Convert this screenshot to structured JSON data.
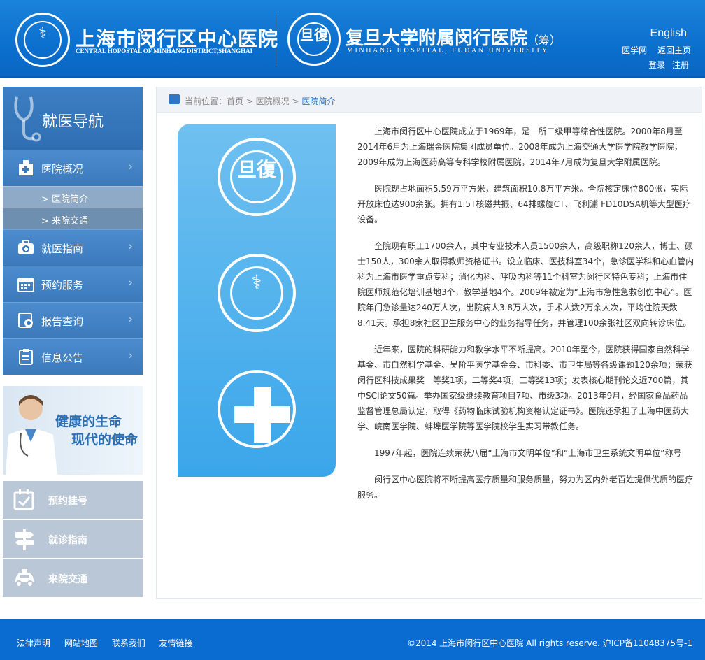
{
  "header": {
    "logo1_glyph": "⚕",
    "hospital_cn": "上海市闵行区中心医院",
    "hospital_en": "CENTRAL HOPOSTAL OF MINHANG DISTRICT,SHANGHAI",
    "logo2_glyph": "旦復",
    "fudan_cn": "复旦大学附属闵行医院",
    "fudan_suffix": "（筹）",
    "fudan_en": "MINHANG HOSPITAL, FUDAN UNIVERSITY",
    "english": "English",
    "links": [
      "医学网",
      "返回主页"
    ],
    "links2": [
      "登录",
      "注册"
    ]
  },
  "sidebar": {
    "title": "就医导航",
    "items": [
      {
        "label": "医院概况",
        "icon": "hospital-icon"
      },
      {
        "label": "就医指南",
        "icon": "medkit-icon"
      },
      {
        "label": "预约服务",
        "icon": "calendar-icon"
      },
      {
        "label": "报告查询",
        "icon": "report-icon"
      },
      {
        "label": "信息公告",
        "icon": "notice-icon"
      }
    ],
    "subitems": [
      "> 医院简介",
      "> 来院交通"
    ],
    "chevron": "›"
  },
  "banner": {
    "line1": "健康的生命",
    "line2": "现代的使命"
  },
  "quick": [
    {
      "label": "预约挂号",
      "icon": "calendar-check-icon"
    },
    {
      "label": "就诊指南",
      "icon": "signpost-icon"
    },
    {
      "label": "来院交通",
      "icon": "car-icon"
    }
  ],
  "breadcrumb": {
    "prefix": "当前位置：首页 > 医院概况 > ",
    "current": "医院简介"
  },
  "art": {
    "fudan_glyph": "旦復",
    "hospital_glyph": "⚕"
  },
  "content": [
    "上海市闵行区中心医院成立于1969年，是一所二级甲等综合性医院。2000年8月至2014年6月为上海瑞金医院集团成员单位。2008年成为上海交通大学医学院教学医院，2009年成为上海医药高等专科学校附属医院，2014年7月成为复旦大学附属医院。",
    "医院现占地面积5.59万平方米，建筑面积10.8万平方米。全院核定床位800张，实际开放床位达900余张。拥有1.5T核磁共振、64排螺旋CT、飞利浦 FD10DSA机等大型医疗设备。",
    "全院现有职工1700余人，其中专业技术人员1500余人，高级职称120余人，博士、硕士150人，300余人取得教师资格证书。设立临床、医技科室34个，急诊医学科和心血管内科为上海市医学重点专科；消化内科、呼吸内科等11个科室为闵行区特色专科；上海市住院医师规范化培训基地3个，教学基地4个。2009年被定为“上海市急性急救创伤中心”。医院年门急诊量达240万人次，出院病人3.8万人次，手术人数2万余人次，平均住院天数8.41天。承担8家社区卫生服务中心的业务指导任务，并管理100余张社区双向转诊床位。",
    "近年来，医院的科研能力和教学水平不断提高。2010年至今，医院获得国家自然科学基金、市自然科学基金、吴阶平医学基金会、市科委、市卫生局等各级课题120余项；荣获闵行区科技成果奖一等奖1项，二等奖4项，三等奖13项；发表核心期刊论文近700篇，其中SCI论文50篇。举办国家级继续教育项目7项、市级3项。2013年9月，经国家食品药品监督管理总局认定，取得《药物临床试验机构资格认定证书》。医院还承担了上海中医药大学、皖南医学院、蚌埠医学院等医学院校学生实习带教任务。",
    "1997年起，医院连续荣获八届“上海市文明单位”和“上海市卫生系统文明单位”称号",
    "闵行区中心医院将不断提高医疗质量和服务质量，努力为区内外老百姓提供优质的医疗服务。"
  ],
  "footer": {
    "links": [
      "法律声明",
      "网站地图",
      "联系我们",
      "友情链接"
    ],
    "copyright": "©2014 上海市闵行区中心医院 All rights reserve.   沪ICP备11048375号-1"
  }
}
